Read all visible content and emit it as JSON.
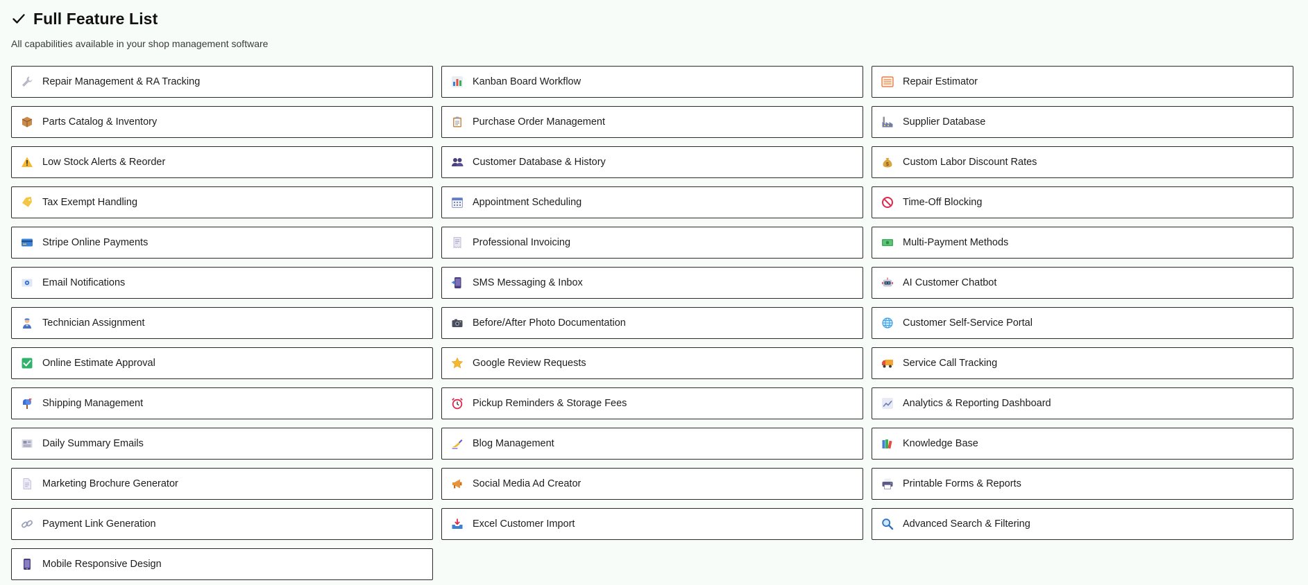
{
  "header": {
    "title": "Full Feature List",
    "subtitle": "All capabilities available in your shop management software"
  },
  "features": [
    {
      "label": "Repair Management & RA Tracking",
      "icon": "wrench-icon"
    },
    {
      "label": "Kanban Board Workflow",
      "icon": "bar-chart-icon"
    },
    {
      "label": "Repair Estimator",
      "icon": "ledger-icon"
    },
    {
      "label": "Parts Catalog & Inventory",
      "icon": "package-icon"
    },
    {
      "label": "Purchase Order Management",
      "icon": "clipboard-icon"
    },
    {
      "label": "Supplier Database",
      "icon": "factory-icon"
    },
    {
      "label": "Low Stock Alerts & Reorder",
      "icon": "warning-icon"
    },
    {
      "label": "Customer Database & History",
      "icon": "users-icon"
    },
    {
      "label": "Custom Labor Discount Rates",
      "icon": "money-bag-icon"
    },
    {
      "label": "Tax Exempt Handling",
      "icon": "tag-icon"
    },
    {
      "label": "Appointment Scheduling",
      "icon": "calendar-icon"
    },
    {
      "label": "Time-Off Blocking",
      "icon": "prohibited-icon"
    },
    {
      "label": "Stripe Online Payments",
      "icon": "credit-card-icon"
    },
    {
      "label": "Professional Invoicing",
      "icon": "receipt-icon"
    },
    {
      "label": "Multi-Payment Methods",
      "icon": "banknote-icon"
    },
    {
      "label": "Email Notifications",
      "icon": "email-icon"
    },
    {
      "label": "SMS Messaging & Inbox",
      "icon": "mobile-message-icon"
    },
    {
      "label": "AI Customer Chatbot",
      "icon": "robot-icon"
    },
    {
      "label": "Technician Assignment",
      "icon": "mechanic-icon"
    },
    {
      "label": "Before/After Photo Documentation",
      "icon": "camera-icon"
    },
    {
      "label": "Customer Self-Service Portal",
      "icon": "globe-icon"
    },
    {
      "label": "Online Estimate Approval",
      "icon": "check-box-icon"
    },
    {
      "label": "Google Review Requests",
      "icon": "star-icon"
    },
    {
      "label": "Service Call Tracking",
      "icon": "truck-icon"
    },
    {
      "label": "Shipping Management",
      "icon": "mailbox-icon"
    },
    {
      "label": "Pickup Reminders & Storage Fees",
      "icon": "alarm-clock-icon"
    },
    {
      "label": "Analytics & Reporting Dashboard",
      "icon": "line-chart-icon"
    },
    {
      "label": "Daily Summary Emails",
      "icon": "newspaper-icon"
    },
    {
      "label": "Blog Management",
      "icon": "writing-hand-icon"
    },
    {
      "label": "Knowledge Base",
      "icon": "books-icon"
    },
    {
      "label": "Marketing Brochure Generator",
      "icon": "document-icon"
    },
    {
      "label": "Social Media Ad Creator",
      "icon": "megaphone-icon"
    },
    {
      "label": "Printable Forms & Reports",
      "icon": "printer-icon"
    },
    {
      "label": "Payment Link Generation",
      "icon": "link-icon"
    },
    {
      "label": "Excel Customer Import",
      "icon": "inbox-tray-icon"
    },
    {
      "label": "Advanced Search & Filtering",
      "icon": "magnifier-icon"
    },
    {
      "label": "Mobile Responsive Design",
      "icon": "phone-icon"
    }
  ]
}
